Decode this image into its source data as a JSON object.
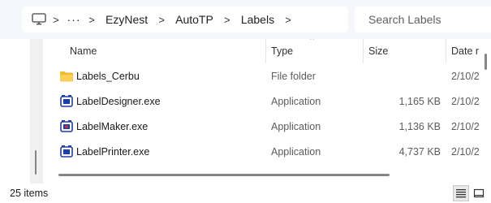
{
  "address_bar": {
    "more_label": "···",
    "breadcrumbs": [
      "EzyNest",
      "AutoTP",
      "Labels"
    ],
    "separator": ">"
  },
  "search": {
    "placeholder": "Search Labels",
    "value": ""
  },
  "columns": {
    "name": "Name",
    "type": "Type",
    "size": "Size",
    "date": "Date r"
  },
  "sort_indicator": "^",
  "files": [
    {
      "name": "Labels_Cerbu",
      "type": "File folder",
      "size": "",
      "date": "2/10/2",
      "icon": "folder-icon"
    },
    {
      "name": "LabelDesigner.exe",
      "type": "Application",
      "size": "1,165 KB",
      "date": "2/10/2",
      "icon": "label-designer-app-icon"
    },
    {
      "name": "LabelMaker.exe",
      "type": "Application",
      "size": "1,136 KB",
      "date": "2/10/2",
      "icon": "label-maker-app-icon"
    },
    {
      "name": "LabelPrinter.exe",
      "type": "Application",
      "size": "4,737 KB",
      "date": "2/10/2",
      "icon": "label-printer-app-icon"
    }
  ],
  "status": {
    "item_count": "25 items"
  },
  "colors": {
    "topbar_bg": "#f3f6fb",
    "folder_yellow": "#f7c948",
    "app_blue": "#1f3fa8"
  }
}
